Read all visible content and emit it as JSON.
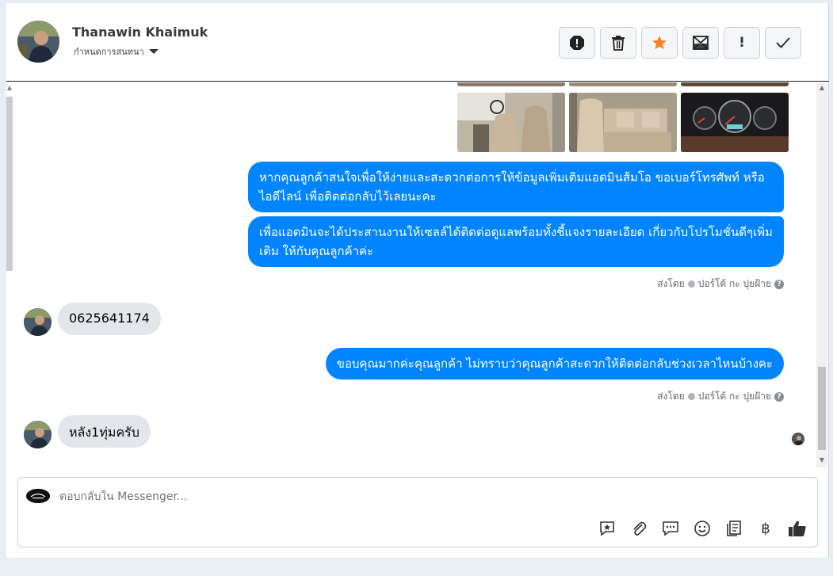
{
  "header": {
    "contact_name": "Thanawin Khaimuk",
    "assign_label": "กำหนดการสนทนา",
    "tools": [
      {
        "icon": "alert-icon",
        "glyph": "!"
      },
      {
        "icon": "trash-icon",
        "glyph": "🗑"
      },
      {
        "icon": "star-icon",
        "glyph": "★"
      },
      {
        "icon": "mail-icon",
        "glyph": "✉"
      },
      {
        "icon": "exclamation-icon",
        "glyph": "!"
      },
      {
        "icon": "check-icon",
        "glyph": "✓"
      }
    ]
  },
  "messages": [
    {
      "from": "page",
      "text": "หากคุณลูกค้าสนใจเพื่อให้ง่ายและสะดวกต่อการให้ข้อมูลเพิ่มเติมแอดมินส้มโอ ขอเบอร์โทรศัพท์ หรือ ไอดีไลน์ เพื่อติดต่อกลับไว้เลยนะคะ"
    },
    {
      "from": "page",
      "text": "เพื่อแอดมินจะได้ประสานงานให้เซลล์ได้ติดต่อดูแลพร้อมทั้งชี้แจงรายละเอียด เกี่ยวกับโปรโมชั่นดีๆเพิ่มเติม ให้กับคุณลูกค้าค่ะ"
    },
    {
      "from": "user",
      "text": "0625641174"
    },
    {
      "from": "page",
      "text": "ขอบคุณมากค่ะคุณลูกค้า ไม่ทราบว่าคุณลูกค้าสะดวกให้ติดต่อกลับช่วงเวลาไหนบ้างคะ"
    },
    {
      "from": "user",
      "text": "หลัง1ทุ่มครับ"
    }
  ],
  "sent_by": {
    "prefix": "ส่งโดย",
    "sender": "ปอร์โต้ กะ ปุยฝ้าย"
  },
  "composer": {
    "placeholder": "ตอบกลับใน Messenger...",
    "tools": [
      {
        "icon": "saved-reply-icon",
        "glyph": "✪"
      },
      {
        "icon": "attach-icon",
        "glyph": "📎"
      },
      {
        "icon": "chat-icon",
        "glyph": "💬"
      },
      {
        "icon": "emoji-icon",
        "glyph": "☺"
      },
      {
        "icon": "notes-icon",
        "glyph": "❐"
      },
      {
        "icon": "baht-icon",
        "glyph": "฿"
      },
      {
        "icon": "thumbs-up-icon",
        "glyph": "👍"
      }
    ]
  },
  "colors": {
    "outgoing_bubble": "#0084ff",
    "incoming_bubble": "#e4e6eb",
    "star": "#f5821f"
  }
}
